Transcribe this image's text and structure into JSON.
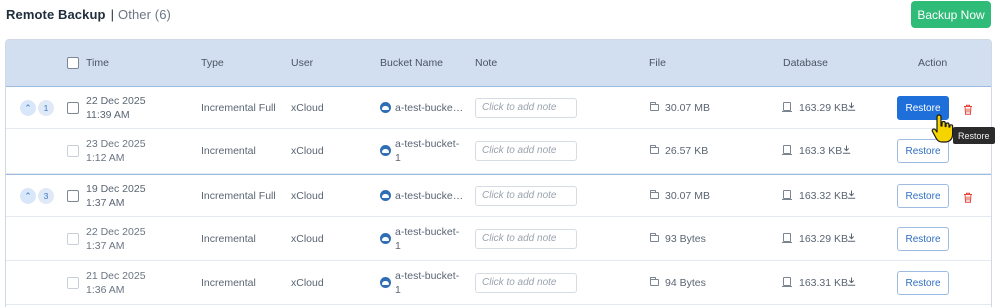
{
  "header": {
    "title": "Remote Backup",
    "separator": "|",
    "other_label": "Other (6)",
    "backup_now_label": "Backup Now"
  },
  "columns": {
    "time": "Time",
    "type": "Type",
    "user": "User",
    "bucket": "Bucket Name",
    "note": "Note",
    "file": "File",
    "database": "Database",
    "action": "Action"
  },
  "rows": [
    {
      "expand_icon": "chevron-up",
      "count": "1",
      "time": "22 Dec 2025 11:39 AM",
      "type": "Incremental Full",
      "user": "xCloud",
      "bucket": "a-test-bucke…",
      "note_placeholder": "Click to add note",
      "file": "30.07 MB",
      "database": "163.29 KB",
      "restore_label": "Restore",
      "restore_style": "primary",
      "has_delete": true
    },
    {
      "time": "23 Dec 2025 1:12 AM",
      "type": "Incremental",
      "user": "xCloud",
      "bucket": "a-test-bucket-1",
      "note_placeholder": "Click to add note",
      "file": "26.57 KB",
      "database": "163.3 KB",
      "restore_label": "Restore",
      "restore_style": "outline",
      "has_delete": false
    },
    {
      "expand_icon": "chevron-up",
      "count": "3",
      "time": "19 Dec 2025 1:37 AM",
      "type": "Incremental Full",
      "user": "xCloud",
      "bucket": "a-test-bucke…",
      "note_placeholder": "Click to add note",
      "file": "30.07 MB",
      "database": "163.32 KB",
      "restore_label": "Restore",
      "restore_style": "outline",
      "has_delete": true
    },
    {
      "time": "22 Dec 2025 1:37 AM",
      "type": "Incremental",
      "user": "xCloud",
      "bucket": "a-test-bucket-1",
      "note_placeholder": "Click to add note",
      "file": "93 Bytes",
      "database": "163.29 KB",
      "restore_label": "Restore",
      "restore_style": "outline",
      "has_delete": false
    },
    {
      "time": "21 Dec 2025 1:36 AM",
      "type": "Incremental",
      "user": "xCloud",
      "bucket": "a-test-bucket-1",
      "note_placeholder": "Click to add note",
      "file": "94 Bytes",
      "database": "163.31 KB",
      "restore_label": "Restore",
      "restore_style": "outline",
      "has_delete": false
    }
  ],
  "tooltip": {
    "text": "Restore"
  },
  "colors": {
    "accent": "#1e6fd9",
    "success": "#2fbb78",
    "danger": "#e0443a",
    "header_bg": "#d2dff0"
  }
}
